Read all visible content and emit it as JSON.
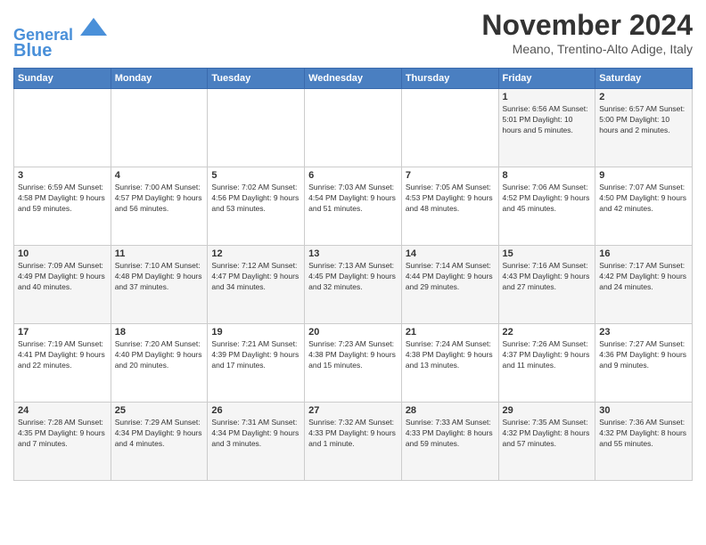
{
  "header": {
    "logo_line1": "General",
    "logo_line2": "Blue",
    "month": "November 2024",
    "location": "Meano, Trentino-Alto Adige, Italy"
  },
  "days_of_week": [
    "Sunday",
    "Monday",
    "Tuesday",
    "Wednesday",
    "Thursday",
    "Friday",
    "Saturday"
  ],
  "weeks": [
    [
      {
        "day": "",
        "info": ""
      },
      {
        "day": "",
        "info": ""
      },
      {
        "day": "",
        "info": ""
      },
      {
        "day": "",
        "info": ""
      },
      {
        "day": "",
        "info": ""
      },
      {
        "day": "1",
        "info": "Sunrise: 6:56 AM\nSunset: 5:01 PM\nDaylight: 10 hours and 5 minutes."
      },
      {
        "day": "2",
        "info": "Sunrise: 6:57 AM\nSunset: 5:00 PM\nDaylight: 10 hours and 2 minutes."
      }
    ],
    [
      {
        "day": "3",
        "info": "Sunrise: 6:59 AM\nSunset: 4:58 PM\nDaylight: 9 hours and 59 minutes."
      },
      {
        "day": "4",
        "info": "Sunrise: 7:00 AM\nSunset: 4:57 PM\nDaylight: 9 hours and 56 minutes."
      },
      {
        "day": "5",
        "info": "Sunrise: 7:02 AM\nSunset: 4:56 PM\nDaylight: 9 hours and 53 minutes."
      },
      {
        "day": "6",
        "info": "Sunrise: 7:03 AM\nSunset: 4:54 PM\nDaylight: 9 hours and 51 minutes."
      },
      {
        "day": "7",
        "info": "Sunrise: 7:05 AM\nSunset: 4:53 PM\nDaylight: 9 hours and 48 minutes."
      },
      {
        "day": "8",
        "info": "Sunrise: 7:06 AM\nSunset: 4:52 PM\nDaylight: 9 hours and 45 minutes."
      },
      {
        "day": "9",
        "info": "Sunrise: 7:07 AM\nSunset: 4:50 PM\nDaylight: 9 hours and 42 minutes."
      }
    ],
    [
      {
        "day": "10",
        "info": "Sunrise: 7:09 AM\nSunset: 4:49 PM\nDaylight: 9 hours and 40 minutes."
      },
      {
        "day": "11",
        "info": "Sunrise: 7:10 AM\nSunset: 4:48 PM\nDaylight: 9 hours and 37 minutes."
      },
      {
        "day": "12",
        "info": "Sunrise: 7:12 AM\nSunset: 4:47 PM\nDaylight: 9 hours and 34 minutes."
      },
      {
        "day": "13",
        "info": "Sunrise: 7:13 AM\nSunset: 4:45 PM\nDaylight: 9 hours and 32 minutes."
      },
      {
        "day": "14",
        "info": "Sunrise: 7:14 AM\nSunset: 4:44 PM\nDaylight: 9 hours and 29 minutes."
      },
      {
        "day": "15",
        "info": "Sunrise: 7:16 AM\nSunset: 4:43 PM\nDaylight: 9 hours and 27 minutes."
      },
      {
        "day": "16",
        "info": "Sunrise: 7:17 AM\nSunset: 4:42 PM\nDaylight: 9 hours and 24 minutes."
      }
    ],
    [
      {
        "day": "17",
        "info": "Sunrise: 7:19 AM\nSunset: 4:41 PM\nDaylight: 9 hours and 22 minutes."
      },
      {
        "day": "18",
        "info": "Sunrise: 7:20 AM\nSunset: 4:40 PM\nDaylight: 9 hours and 20 minutes."
      },
      {
        "day": "19",
        "info": "Sunrise: 7:21 AM\nSunset: 4:39 PM\nDaylight: 9 hours and 17 minutes."
      },
      {
        "day": "20",
        "info": "Sunrise: 7:23 AM\nSunset: 4:38 PM\nDaylight: 9 hours and 15 minutes."
      },
      {
        "day": "21",
        "info": "Sunrise: 7:24 AM\nSunset: 4:38 PM\nDaylight: 9 hours and 13 minutes."
      },
      {
        "day": "22",
        "info": "Sunrise: 7:26 AM\nSunset: 4:37 PM\nDaylight: 9 hours and 11 minutes."
      },
      {
        "day": "23",
        "info": "Sunrise: 7:27 AM\nSunset: 4:36 PM\nDaylight: 9 hours and 9 minutes."
      }
    ],
    [
      {
        "day": "24",
        "info": "Sunrise: 7:28 AM\nSunset: 4:35 PM\nDaylight: 9 hours and 7 minutes."
      },
      {
        "day": "25",
        "info": "Sunrise: 7:29 AM\nSunset: 4:34 PM\nDaylight: 9 hours and 4 minutes."
      },
      {
        "day": "26",
        "info": "Sunrise: 7:31 AM\nSunset: 4:34 PM\nDaylight: 9 hours and 3 minutes."
      },
      {
        "day": "27",
        "info": "Sunrise: 7:32 AM\nSunset: 4:33 PM\nDaylight: 9 hours and 1 minute."
      },
      {
        "day": "28",
        "info": "Sunrise: 7:33 AM\nSunset: 4:33 PM\nDaylight: 8 hours and 59 minutes."
      },
      {
        "day": "29",
        "info": "Sunrise: 7:35 AM\nSunset: 4:32 PM\nDaylight: 8 hours and 57 minutes."
      },
      {
        "day": "30",
        "info": "Sunrise: 7:36 AM\nSunset: 4:32 PM\nDaylight: 8 hours and 55 minutes."
      }
    ]
  ]
}
